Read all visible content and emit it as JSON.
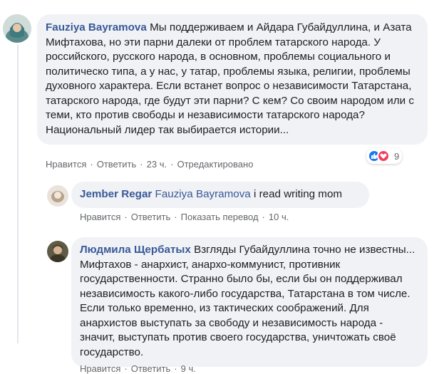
{
  "comments": [
    {
      "author": "Fauziya Bayramova",
      "text": "Мы поддерживаем и Айдара Губайдуллина, и Азата Мифтахова, но эти парни далеки от проблем татарского народа. У российского, русского народа, в основном, проблемы социального и политическо типа, а у нас, у татар, проблемы языка, религии, проблемы духовного характера. Если встанет вопрос о независимости Татарстана, татарского народа, где будут эти парни? С кем? Со своим народом или с теми, кто против свободы и независимости татарского народа? Национальный лидер так выбирается истории...",
      "like": "Нравится",
      "reply": "Ответить",
      "time": "23 ч.",
      "edited": "Отредактировано",
      "reaction_count": "9",
      "like_color": "#1877f2",
      "love_color": "#f33e58"
    },
    {
      "author": "Jember Regar",
      "mention": "Fauziya Bayramova",
      "text": " i read writing mom",
      "like": "Нравится",
      "reply": "Ответить",
      "translate": "Показать перевод",
      "time": "10 ч."
    },
    {
      "author": "Людмила Щербатых",
      "text": "Взгляды Губайдуллина точно не известны... Мифтахов - анархист, анархо-коммунист, противник государственности. Странно было бы, если бы он поддерживал независимость какого-либо государства, Татарстана в том числе. Если только временно, из тактических соображений. Для анархистов выступать за свободу и независимость народа - значит, выступать против своего государства, уничтожать своё государство.",
      "like": "Нравится",
      "reply": "Ответить",
      "time": "9 ч."
    }
  ],
  "icons": {
    "like": "thumbs-up-icon",
    "love": "heart-icon"
  },
  "colors": {
    "bubble": "#f0f2f5",
    "author": "#385898",
    "meta": "#65676b"
  }
}
